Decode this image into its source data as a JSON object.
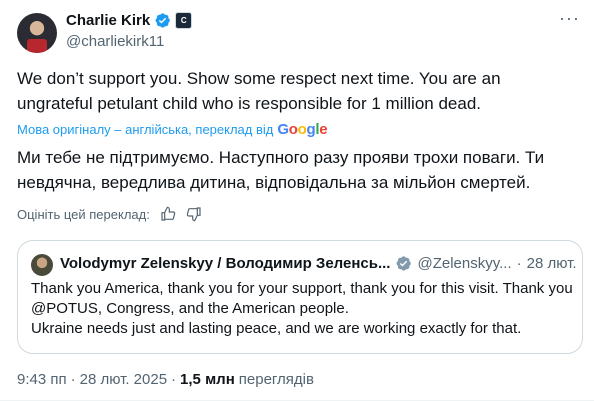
{
  "author": {
    "name": "Charlie Kirk",
    "handle": "@charliekirk11",
    "affiliate_badge": "C"
  },
  "more_icon": "···",
  "tweet": {
    "text": "We don’t support you. Show some respect next time. You are an ungrateful petulant child who is responsible for 1 million dead.",
    "translation_note": "Мова оригіналу – англійська, переклад від",
    "translation_provider": "Google",
    "translated_text": "Ми тебе не підтримуємо. Наступного разу прояви трохи поваги. Ти невдячна, вередлива дитина, відповідальна за мільйон смертей.",
    "rate_label": "Оцініть цей переклад:"
  },
  "quote": {
    "name": "Volodymyr Zelenskyy / Володимир Зеленсь...",
    "handle": "@Zelenskyy...",
    "dot": "·",
    "date": "28 лют.",
    "text": "Thank you America, thank you for your support, thank you for this visit. Thank you @POTUS, Congress, and the American people.\nUkraine needs just and lasting peace, and we are working exactly for that."
  },
  "meta": {
    "time": "9:43 пп",
    "dot1": "·",
    "date": "28 лют. 2025",
    "dot2": "·",
    "views_count": "1,5 млн",
    "views_label": "переглядів"
  },
  "colors": {
    "accent": "#1d9bf0",
    "secondary_text": "#536471",
    "border": "#cfd9de"
  }
}
